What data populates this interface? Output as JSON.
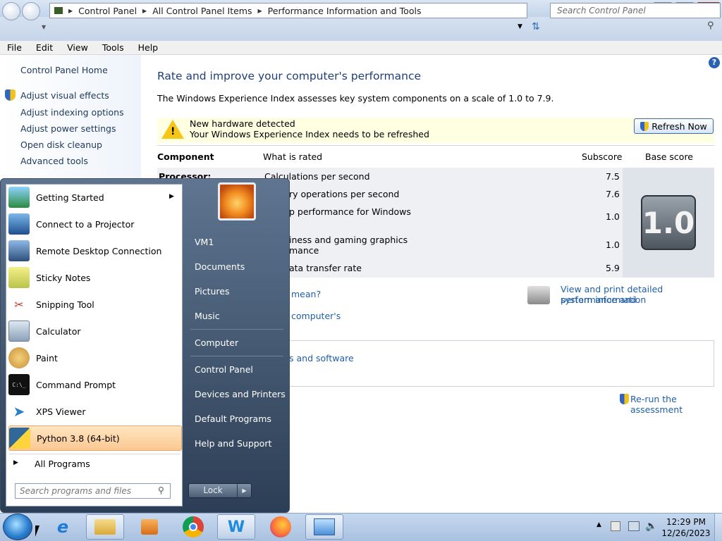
{
  "window": {
    "breadcrumb": [
      "Control Panel",
      "All Control Panel Items",
      "Performance Information and Tools"
    ],
    "search_placeholder": "Search Control Panel",
    "menu": [
      "File",
      "Edit",
      "View",
      "Tools",
      "Help"
    ]
  },
  "left_pane": {
    "home": "Control Panel Home",
    "links": [
      "Adjust visual effects",
      "Adjust indexing options",
      "Adjust power settings",
      "Open disk cleanup",
      "Advanced tools"
    ]
  },
  "main": {
    "title": "Rate and improve your computer's performance",
    "description": "The Windows Experience Index assesses key system components on a scale of 1.0 to 7.9.",
    "notice_title": "New hardware detected",
    "notice_body": "Your Windows Experience Index needs to be refreshed",
    "refresh_label": "Refresh Now",
    "headers": {
      "component": "Component",
      "rated": "What is rated",
      "subscore": "Subscore",
      "base": "Base score"
    },
    "rows": [
      {
        "component": "Processor:",
        "rated": "Calculations per second",
        "subscore": "7.5"
      },
      {
        "component": "",
        "rated": "ry operations per second",
        "subscore": "7.6"
      },
      {
        "component": "",
        "rated": "p performance for Windows",
        "subscore": "1.0"
      },
      {
        "component": "",
        "rated": "iness and gaming graphics",
        "rated2": "mance",
        "subscore": "1.0"
      },
      {
        "component": "",
        "rated": "ata transfer rate",
        "subscore": "5.9"
      }
    ],
    "base_score": "1.0",
    "link_mean": "mean?",
    "link_computer": "computer's",
    "link_software": "s and software",
    "print_link_1": "View and print detailed performance and",
    "print_link_2": "system information",
    "rerun": "Re-run the assessment"
  },
  "start_menu": {
    "programs": [
      {
        "label": "Getting Started",
        "icon": "getting-started-icon",
        "submenu": true
      },
      {
        "label": "Connect to a Projector",
        "icon": "projector-icon"
      },
      {
        "label": "Remote Desktop Connection",
        "icon": "remote-desktop-icon"
      },
      {
        "label": "Sticky Notes",
        "icon": "sticky-notes-icon"
      },
      {
        "label": "Snipping Tool",
        "icon": "scissors-icon"
      },
      {
        "label": "Calculator",
        "icon": "calculator-icon"
      },
      {
        "label": "Paint",
        "icon": "paint-palette-icon"
      },
      {
        "label": "Command Prompt",
        "icon": "terminal-icon"
      },
      {
        "label": "XPS Viewer",
        "icon": "xps-viewer-icon"
      },
      {
        "label": "Python 3.8 (64-bit)",
        "icon": "python-icon"
      }
    ],
    "all_programs": "All Programs",
    "search_placeholder": "Search programs and files",
    "right_links": [
      "VM1",
      "Documents",
      "Pictures",
      "Music",
      "Computer",
      "Control Panel",
      "Devices and Printers",
      "Default Programs",
      "Help and Support"
    ],
    "lock": "Lock"
  },
  "taskbar": {
    "time": "12:29 PM",
    "date": "12/26/2023",
    "apps": [
      "internet-explorer-icon",
      "file-explorer-icon",
      "media-player-icon",
      "chrome-icon",
      "word-app-icon",
      "firefox-icon",
      "control-panel-icon"
    ]
  }
}
